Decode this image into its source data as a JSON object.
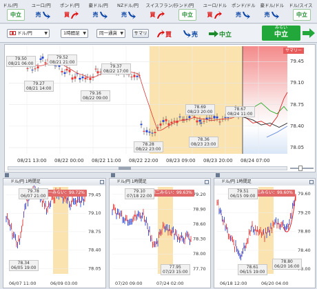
{
  "pairs": [
    {
      "name": "ドル/円",
      "signal": "中立",
      "type": "neutral"
    },
    {
      "name": "ユーロ/円",
      "signal": "売",
      "type": "sell"
    },
    {
      "name": "ポンド/円",
      "signal": "買",
      "type": "buy"
    },
    {
      "name": "豪ドル/円",
      "signal": "売",
      "type": "sell"
    },
    {
      "name": "NZドル/円",
      "signal": "売",
      "type": "sell"
    },
    {
      "name": "スイスフラン/円",
      "signal": "買",
      "type": "buy"
    },
    {
      "name": "ランド/円",
      "signal": "中立",
      "type": "neutral"
    },
    {
      "name": "ユーロ/ドル",
      "signal": "買",
      "type": "buy"
    },
    {
      "name": "ポンド/ドル",
      "signal": "売",
      "type": "sell"
    },
    {
      "name": "豪ドル/ドル",
      "signal": "売",
      "type": "sell"
    },
    {
      "name": "ドル/スイス",
      "signal": "中立",
      "type": "neutral"
    }
  ],
  "toolbar": {
    "pair_select": "ドル/円",
    "timeframe_select": "1時間足",
    "mode_select": "同一通貨",
    "summary_button": "サマリ",
    "legend_buy": "買",
    "legend_sell": "売",
    "legend_neutral": "中立",
    "forecast_small": "みらい",
    "forecast_big": "中立"
  },
  "main": {
    "summary_tab": "サマリー",
    "y_ticks": [
      "79.45",
      "79.10",
      "78.75",
      "78.40",
      "78.05"
    ],
    "x_ticks": [
      "08/21 13:00",
      "08/22 00:00",
      "08/22 11:00",
      "08/22 22:00",
      "08/23 09:00",
      "08/23 20:00",
      "08/24 07:00"
    ],
    "callouts": [
      {
        "v": "79.50",
        "t": "08/21 06:00"
      },
      {
        "v": "79.52",
        "t": "08/21 21:00"
      },
      {
        "v": "79.27",
        "t": "08/21 14:00"
      },
      {
        "v": "79.37",
        "t": "08/22 17:00"
      },
      {
        "v": "79.16",
        "t": "08/22 09:00"
      },
      {
        "v": "78.28",
        "t": "08/22 23:00"
      },
      {
        "v": "78.69",
        "t": "08/23 20:00"
      },
      {
        "v": "78.67",
        "t": "08/24 11:00"
      },
      {
        "v": "78.36",
        "t": "08/23 23:00"
      }
    ]
  },
  "minis": [
    {
      "title": "ドル/円 1時間足",
      "badge": "第一みらい：99.72%",
      "y_ticks": [
        "79.45",
        "79.10",
        "78.75",
        "78.40",
        "78.05"
      ],
      "x_ticks": [
        "06/07 11:00",
        "06/09 03:00"
      ],
      "hi": {
        "v": "79.78",
        "t": "06/07 21:00"
      },
      "lo": {
        "v": "78.34",
        "t": "06/05 19:00"
      }
    },
    {
      "title": "ドル/円 1時間足",
      "badge": "第二みらい：99.63%",
      "y_ticks": [
        "79.20",
        "78.90",
        "78.60",
        "78.30",
        "78.00",
        "77.70"
      ],
      "x_ticks": [
        "07/20 09:00",
        "07/24 02:00"
      ],
      "hi": {
        "v": "79.10",
        "t": "07/18 22:00"
      },
      "lo": {
        "v": "77.95",
        "t": "07/23 15:00"
      }
    },
    {
      "title": "ドル/円 1時間足",
      "badge": "第三みらい：99.60%",
      "y_ticks": [
        "79.60",
        "79.20",
        "78.80",
        "78.40",
        "78.00"
      ],
      "x_ticks": [
        "06/18 12:00",
        "06/20 04:00"
      ],
      "hi": {
        "v": "79.51",
        "t": "06/15 09:00"
      },
      "lo": {
        "v": "78.61",
        "t": "06/15 19:00"
      },
      "lo2": {
        "v": "78.80",
        "t": "06/20 16:00"
      }
    }
  ]
}
